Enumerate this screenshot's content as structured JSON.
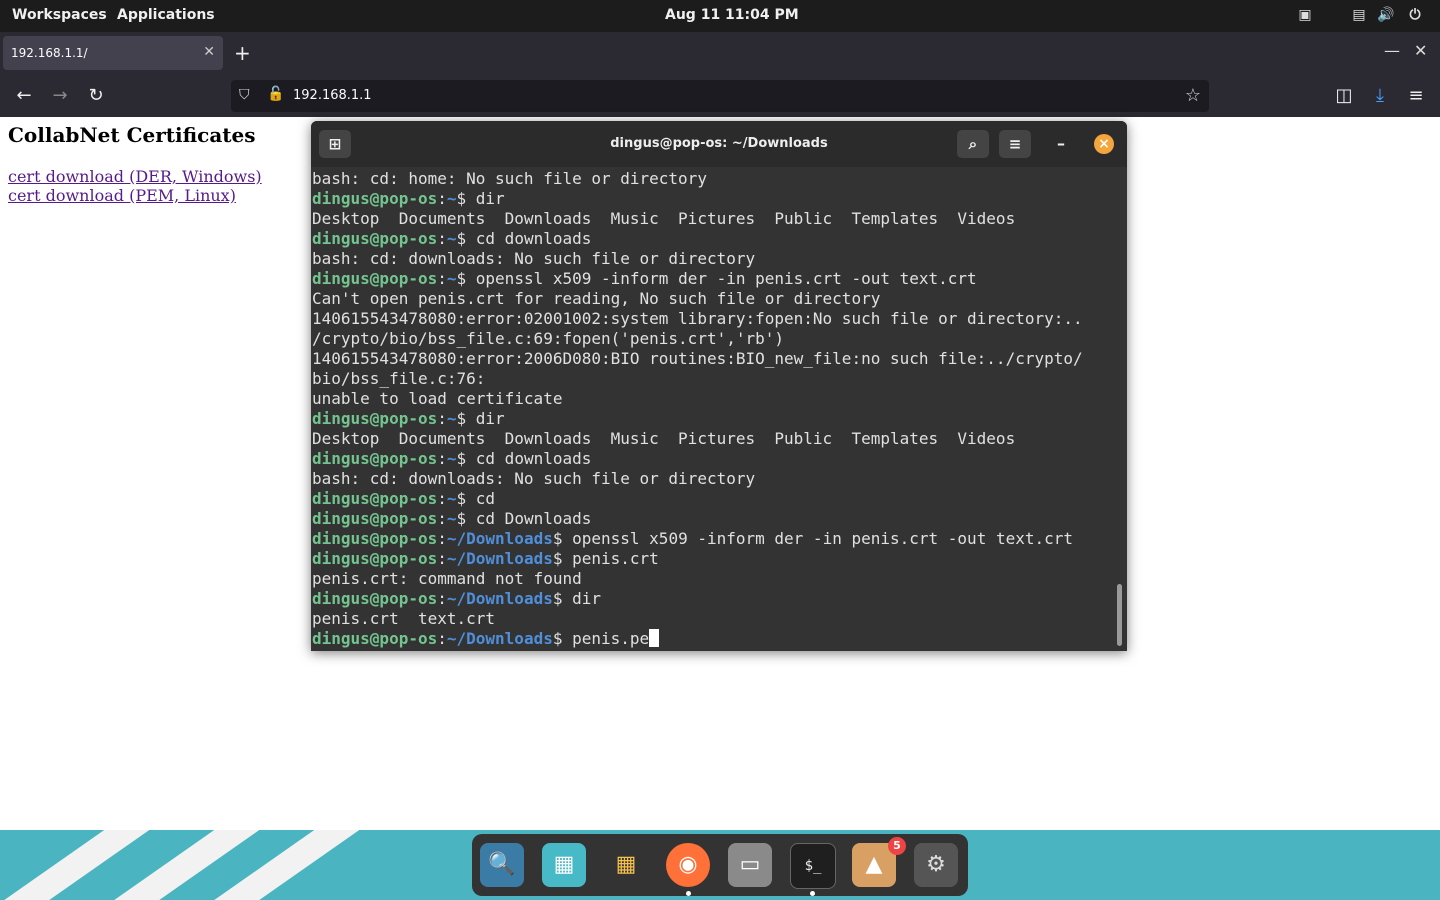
{
  "topbar": {
    "workspaces": "Workspaces",
    "applications": "Applications",
    "clock": "Aug 11  11:04 PM"
  },
  "browser": {
    "tab_title": "192.168.1.1/",
    "url": "192.168.1.1"
  },
  "page": {
    "heading": "CollabNet Certificates",
    "links": [
      "cert download (DER, Windows)",
      "cert download (PEM, Linux)"
    ]
  },
  "terminal": {
    "title": "dingus@pop-os: ~/Downloads",
    "lines": [
      {
        "text": "bash: cd: home: No such file or directory"
      },
      {
        "user": "dingus@pop-os",
        "sep": ":",
        "path": "~",
        "cmd": "$ dir"
      },
      {
        "text": "Desktop  Documents  Downloads  Music  Pictures  Public  Templates  Videos"
      },
      {
        "user": "dingus@pop-os",
        "sep": ":",
        "path": "~",
        "cmd": "$ cd downloads"
      },
      {
        "text": "bash: cd: downloads: No such file or directory"
      },
      {
        "user": "dingus@pop-os",
        "sep": ":",
        "path": "~",
        "cmd": "$ openssl x509 -inform der -in penis.crt -out text.crt"
      },
      {
        "text": "Can't open penis.crt for reading, No such file or directory"
      },
      {
        "text": "140615543478080:error:02001002:system library:fopen:No such file or directory:.."
      },
      {
        "text": "/crypto/bio/bss_file.c:69:fopen('penis.crt','rb')"
      },
      {
        "text": "140615543478080:error:2006D080:BIO routines:BIO_new_file:no such file:../crypto/"
      },
      {
        "text": "bio/bss_file.c:76:"
      },
      {
        "text": "unable to load certificate"
      },
      {
        "user": "dingus@pop-os",
        "sep": ":",
        "path": "~",
        "cmd": "$ dir"
      },
      {
        "text": "Desktop  Documents  Downloads  Music  Pictures  Public  Templates  Videos"
      },
      {
        "user": "dingus@pop-os",
        "sep": ":",
        "path": "~",
        "cmd": "$ cd downloads"
      },
      {
        "text": "bash: cd: downloads: No such file or directory"
      },
      {
        "user": "dingus@pop-os",
        "sep": ":",
        "path": "~",
        "cmd": "$ cd"
      },
      {
        "user": "dingus@pop-os",
        "sep": ":",
        "path": "~",
        "cmd": "$ cd Downloads"
      },
      {
        "user": "dingus@pop-os",
        "sep": ":",
        "path": "~/Downloads",
        "cmd": "$ openssl x509 -inform der -in penis.crt -out text.crt"
      },
      {
        "user": "dingus@pop-os",
        "sep": ":",
        "path": "~/Downloads",
        "cmd": "$ penis.crt"
      },
      {
        "text": "penis.crt: command not found"
      },
      {
        "user": "dingus@pop-os",
        "sep": ":",
        "path": "~/Downloads",
        "cmd": "$ dir"
      },
      {
        "text": "penis.crt  text.crt"
      },
      {
        "user": "dingus@pop-os",
        "sep": ":",
        "path": "~/Downloads",
        "cmd": "$ penis.pe",
        "cursor": true
      }
    ]
  },
  "dock": {
    "items": [
      "search-icon",
      "files-icon",
      "app-grid-icon",
      "firefox-icon",
      "folder-icon",
      "terminal-icon",
      "shop-icon",
      "settings-icon"
    ],
    "badge": "5"
  },
  "colors": {
    "prompt_user": "#73c48f",
    "prompt_path": "#4f8fd9",
    "terminal_bg": "#333333",
    "accent_close": "#f6a43c"
  }
}
